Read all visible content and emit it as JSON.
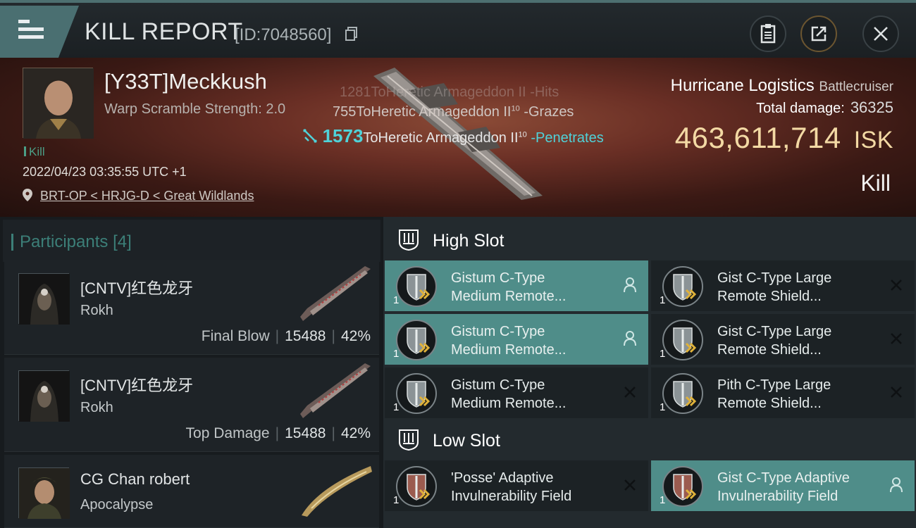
{
  "header": {
    "title": "KILL REPORT",
    "id_label": "[ID:7048560]"
  },
  "victim": {
    "pilot": "[Y33T]Meckkush",
    "warp": "Warp Scramble Strength: 2.0",
    "tag": "Kill",
    "datetime": "2022/04/23 03:35:55 UTC +1",
    "location": "BRT-OP < HRJG-D < Great Wildlands",
    "ship_name": "Hurricane Logistics",
    "ship_class": "Battlecruiser",
    "total_damage_label": "Total damage:",
    "total_damage": "36325",
    "isk_value": "463,611,714",
    "isk_unit": "ISK",
    "result": "Kill"
  },
  "hits": [
    {
      "num": "1281",
      "to": "ToHeretic Armageddon II",
      "sup": "",
      "effect": "-Hits"
    },
    {
      "num": "755",
      "to": "ToHeretic Armageddon II",
      "sup": "10",
      "effect": "-Grazes"
    },
    {
      "num": "1573",
      "to": "ToHeretic Armageddon II",
      "sup": "10",
      "effect": "-Penetrates"
    }
  ],
  "participants": {
    "header": "Participants",
    "count": "[4]",
    "rows": [
      {
        "name": "[CNTV]红色龙牙",
        "ship": "Rokh",
        "label": "Final Blow",
        "damage": "15488",
        "pct": "42%"
      },
      {
        "name": "[CNTV]红色龙牙",
        "ship": "Rokh",
        "label": "Top Damage",
        "damage": "15488",
        "pct": "42%"
      },
      {
        "name": "CG Chan robert",
        "ship": "Apocalypse",
        "label": "",
        "damage": "",
        "pct": ""
      }
    ]
  },
  "fitting": {
    "high_slot": "High Slot",
    "low_slot": "Low Slot",
    "high": [
      {
        "qty": "1",
        "line1": "Gistum C-Type",
        "line2": "Medium Remote...",
        "state": "pilot-icon",
        "active": true
      },
      {
        "qty": "1",
        "line1": "Gist C-Type Large",
        "line2": "Remote Shield...",
        "state": "close-icon",
        "active": false
      },
      {
        "qty": "1",
        "line1": "Gistum C-Type",
        "line2": "Medium Remote...",
        "state": "pilot-icon",
        "active": true
      },
      {
        "qty": "1",
        "line1": "Gist C-Type Large",
        "line2": "Remote Shield...",
        "state": "close-icon",
        "active": false
      },
      {
        "qty": "1",
        "line1": "Gistum C-Type",
        "line2": "Medium Remote...",
        "state": "close-icon",
        "active": false
      },
      {
        "qty": "1",
        "line1": "Pith C-Type Large",
        "line2": "Remote Shield...",
        "state": "close-icon",
        "active": false
      }
    ],
    "low": [
      {
        "qty": "1",
        "line1": "'Posse' Adaptive",
        "line2": "Invulnerability Field",
        "state": "close-icon",
        "active": false
      },
      {
        "qty": "1",
        "line1": "Gist C-Type Adaptive",
        "line2": "Invulnerability Field",
        "state": "pilot-icon",
        "active": true
      }
    ]
  },
  "colors": {
    "accent": "#4f8d89",
    "isk": "#f3d9a4",
    "penetrates": "#4fd2d9"
  }
}
